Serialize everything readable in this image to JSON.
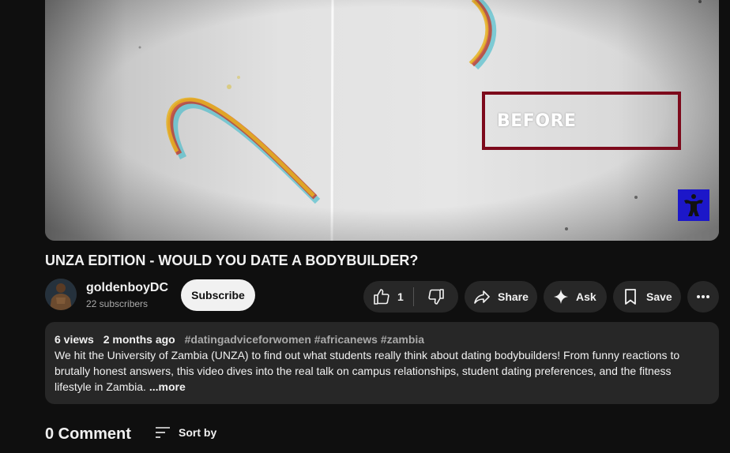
{
  "video": {
    "overlay_text": "BEFORE",
    "overlay_border_color": "#7d0a1c",
    "watermark_color": "#1c17c9",
    "watermark_icon": "bodybuilder-icon"
  },
  "title": "UNZA EDITION - WOULD YOU DATE A BODYBUILDER?",
  "channel": {
    "name": "goldenboyDC",
    "subscribers": "22 subscribers",
    "subscribe_label": "Subscribe"
  },
  "actions": {
    "like_count": "1",
    "share_label": "Share",
    "ask_label": "Ask",
    "save_label": "Save"
  },
  "description": {
    "views": "6 views",
    "age": "2 months ago",
    "hashtags": "#datingadviceforwomen #africanews #zambia",
    "text": "We hit the University of Zambia (UNZA) to find out what students really think about dating bodybuilders! From funny reactions to brutally honest answers, this video dives into the real talk on campus relationships, student dating preferences, and the fitness lifestyle in Zambia.",
    "trailing_fade": "",
    "more_label": "...more"
  },
  "comments": {
    "count_label": "0 Comment",
    "sort_label": "Sort by"
  }
}
